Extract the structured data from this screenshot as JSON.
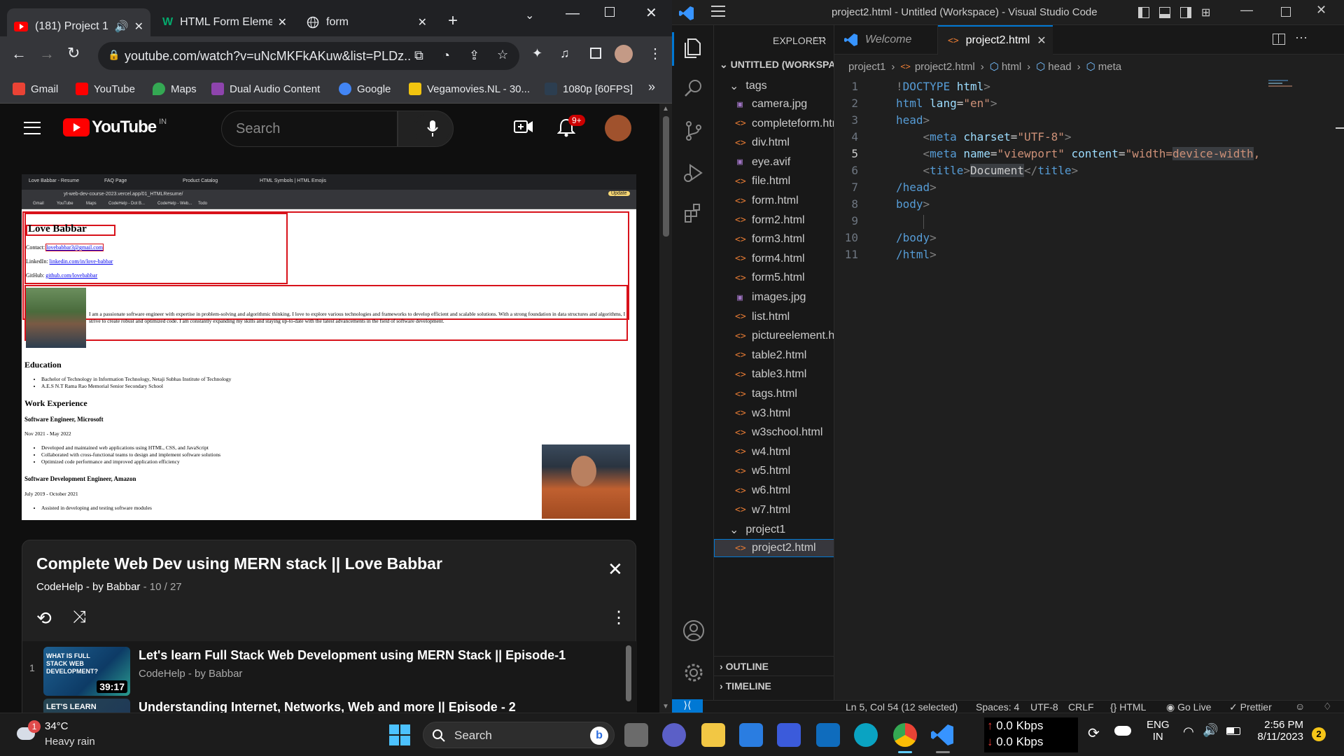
{
  "chrome": {
    "tabs": [
      {
        "label": "(181) Project 1",
        "favicon": "youtube-icon"
      },
      {
        "label": "HTML Form Eleme",
        "favicon": "w3schools-icon"
      },
      {
        "label": "form",
        "favicon": "globe-icon"
      }
    ],
    "new_tab": "+",
    "url": "youtube.com/watch?v=uNcMKFkAKuw&list=PLDz...",
    "bookmarks": [
      {
        "label": "Gmail",
        "color": "#ea4335"
      },
      {
        "label": "YouTube",
        "color": "#ff0000"
      },
      {
        "label": "Maps",
        "color": "#34a853"
      },
      {
        "label": "Dual Audio Content",
        "color": "#8e44ad"
      },
      {
        "label": "Google",
        "color": "#4285f4"
      },
      {
        "label": "Vegamovies.NL - 30...",
        "color": "#f1c40f"
      },
      {
        "label": "1080p [60FPS]",
        "color": "#2c3e50"
      }
    ],
    "more_bookmarks": "»"
  },
  "youtube": {
    "logo": "YouTube",
    "region": "IN",
    "search_placeholder": "Search",
    "notifications": "9+",
    "video": {
      "mini_tabs": [
        "Love Babbar - Resume",
        "FAQ Page",
        "Product Catalog",
        "HTML Symbols | HTML Emojis"
      ],
      "mini_url": "yt-web-dev-course-2023.vercel.app/01_HTMLResume/",
      "mini_update": "Update",
      "mini_bookmarks": [
        "Gmail",
        "YouTube",
        "Maps",
        "CodeHelp - Dot B...",
        "CodeHelp - Web...",
        "Todo"
      ],
      "resume_name": "Love Babbar",
      "contact_label": "Contact:",
      "contact_value": "lovebabbar3@gmail.com",
      "linkedin_label": "LinkedIn:",
      "linkedin_value": "linkedin.com/in/love-babbar",
      "github_label": "GitHub:",
      "github_value": "github.com/lovebabbar",
      "bio": "I am a passionate software engineer with expertise in problem-solving and algorithmic thinking. I love to explore various technologies and frameworks to develop efficient and scalable solutions. With a strong foundation in data structures and algorithms, I strive to create robust and optimized code. I am constantly expanding my skills and staying up-to-date with the latest advancements in the field of software development.",
      "education_heading": "Education",
      "education": [
        "Bachelor of Technology in Information Technology, Netaji Subhas Institute of Technology",
        "A.E.S N.T Rama Rao Memorial Senior Secondary School"
      ],
      "work_heading": "Work Experience",
      "job1_title": "Software Engineer, Microsoft",
      "job1_dates": "Nov 2021 - May 2022",
      "job1_points": [
        "Developed and maintained web applications using HTML, CSS, and JavaScript",
        "Collaborated with cross-functional teams to design and implement software solutions",
        "Optimized code performance and improved application efficiency"
      ],
      "job2_title": "Software Development Engineer, Amazon",
      "job2_dates": "July 2019 - October 2021",
      "job2_points": [
        "Assisted in developing and testing software modules"
      ]
    },
    "playlist": {
      "title": "Complete Web Dev using MERN stack || Love Babbar",
      "channel": "CodeHelp - by Babbar",
      "position": "10 / 27",
      "items": [
        {
          "index": "1",
          "title": "Let's learn Full Stack Web Development using MERN Stack || Episode-1",
          "channel": "CodeHelp - by Babbar",
          "duration": "39:17",
          "thumb_text": "WHAT IS FULL STACK WEB DEVELOPMENT?"
        },
        {
          "index": "",
          "title": "Understanding Internet, Networks, Web and more || Episode - 2",
          "channel": "",
          "duration": "",
          "thumb_text": "LET'S LEARN"
        }
      ]
    }
  },
  "vscode": {
    "title": "project2.html - Untitled (Workspace) - Visual Studio Code",
    "explorer_label": "EXPLORER",
    "workspace": "UNTITLED (WORKSPACE)",
    "folder_tags": "tags",
    "files": [
      {
        "name": "camera.jpg",
        "type": "image"
      },
      {
        "name": "completeform.html",
        "type": "html"
      },
      {
        "name": "div.html",
        "type": "html"
      },
      {
        "name": "eye.avif",
        "type": "image"
      },
      {
        "name": "file.html",
        "type": "html"
      },
      {
        "name": "form.html",
        "type": "html"
      },
      {
        "name": "form2.html",
        "type": "html"
      },
      {
        "name": "form3.html",
        "type": "html"
      },
      {
        "name": "form4.html",
        "type": "html"
      },
      {
        "name": "form5.html",
        "type": "html"
      },
      {
        "name": "images.jpg",
        "type": "image"
      },
      {
        "name": "list.html",
        "type": "html"
      },
      {
        "name": "pictureelement.html",
        "type": "html"
      },
      {
        "name": "table2.html",
        "type": "html"
      },
      {
        "name": "table3.html",
        "type": "html"
      },
      {
        "name": "tags.html",
        "type": "html"
      },
      {
        "name": "w3.html",
        "type": "html"
      },
      {
        "name": "w3school.html",
        "type": "html"
      },
      {
        "name": "w4.html",
        "type": "html"
      },
      {
        "name": "w5.html",
        "type": "html"
      },
      {
        "name": "w6.html",
        "type": "html"
      },
      {
        "name": "w7.html",
        "type": "html"
      }
    ],
    "folder_project1": "project1",
    "project_file": "project2.html",
    "outline": "OUTLINE",
    "timeline": "TIMELINE",
    "editor_tabs": [
      {
        "label": "Welcome"
      },
      {
        "label": "project2.html"
      }
    ],
    "breadcrumb": [
      "project1",
      "project2.html",
      "html",
      "head",
      "meta"
    ],
    "line_numbers": [
      "1",
      "2",
      "3",
      "4",
      "5",
      "6",
      "7",
      "8",
      "9",
      "10",
      "11"
    ],
    "status": {
      "position": "Ln 5, Col 54 (12 selected)",
      "spaces": "Spaces: 4",
      "encoding": "UTF-8",
      "eol": "CRLF",
      "language": "HTML",
      "golive": "Go Live",
      "prettier": "Prettier"
    }
  },
  "taskbar": {
    "weather_temp": "34°C",
    "weather_desc": "Heavy rain",
    "weather_badge": "1",
    "search_label": "Search",
    "net_up": "0.0 Kbps",
    "net_down": "0.0 Kbps",
    "lang_1": "ENG",
    "lang_2": "IN",
    "time": "2:56 PM",
    "date": "8/11/2023",
    "notif_count": "2"
  }
}
